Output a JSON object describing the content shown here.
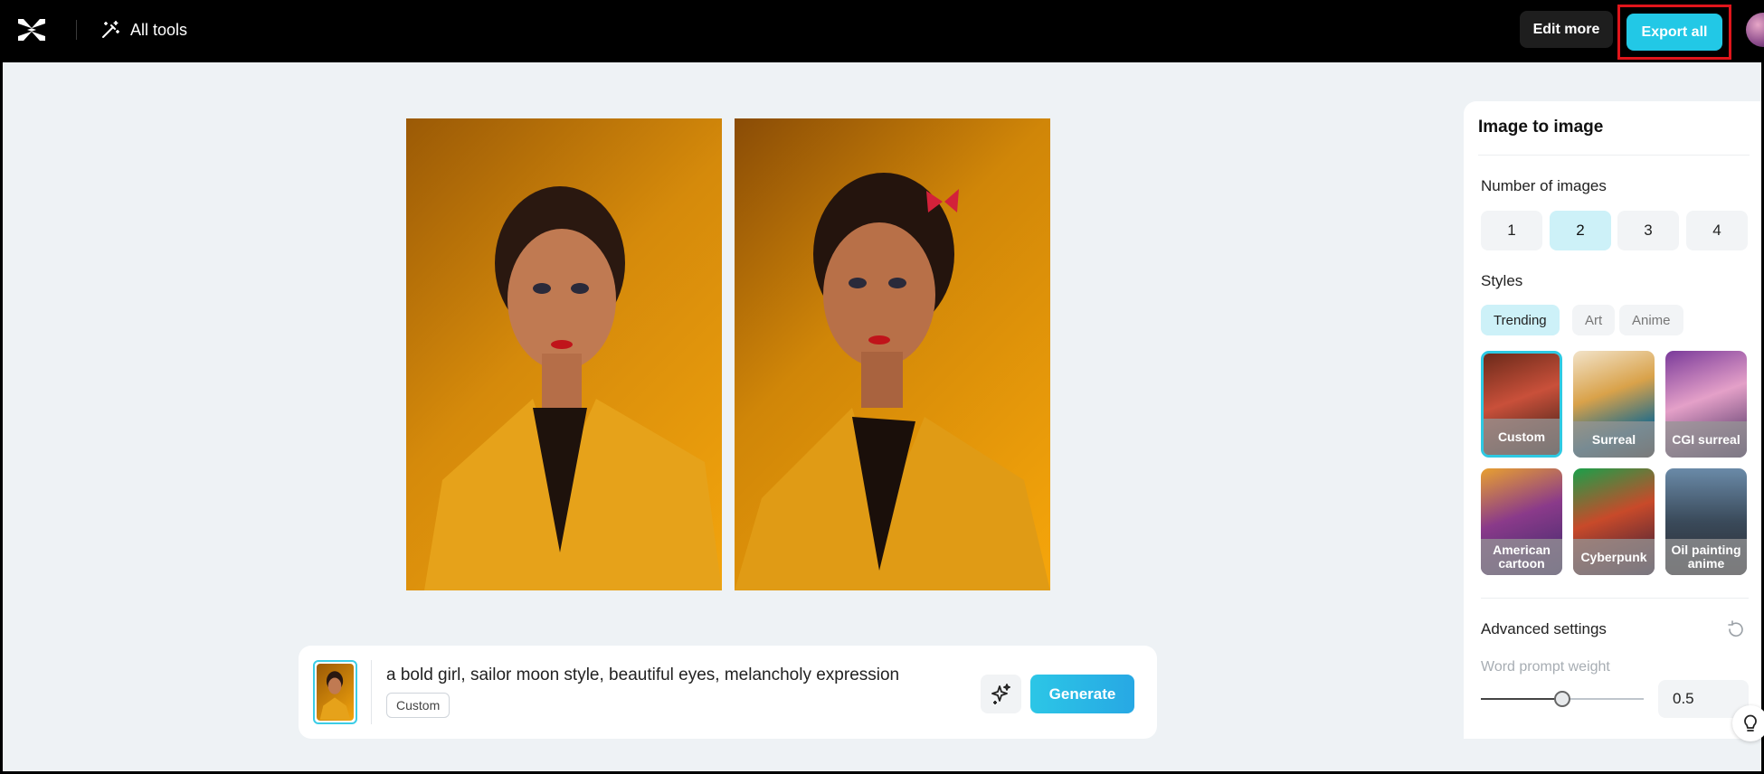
{
  "topbar": {
    "all_tools_label": "All tools",
    "edit_more_label": "Edit more",
    "export_all_label": "Export all"
  },
  "prompt": {
    "text": "a bold girl, sailor moon style, beautiful eyes, melancholy expression",
    "style_chip": "Custom",
    "generate_label": "Generate"
  },
  "panel": {
    "title": "Image to image",
    "number_label": "Number of images",
    "numbers": [
      "1",
      "2",
      "3",
      "4"
    ],
    "selected_number": "2",
    "styles_label": "Styles",
    "style_tabs": [
      "Trending",
      "Art",
      "Anime"
    ],
    "active_tab": "Trending",
    "styles": [
      {
        "label": "Custom"
      },
      {
        "label": "Surreal"
      },
      {
        "label": "CGI surreal"
      },
      {
        "label": "American cartoon"
      },
      {
        "label": "Cyberpunk"
      },
      {
        "label": "Oil painting anime"
      }
    ],
    "advanced_label": "Advanced settings",
    "word_weight_label": "Word prompt weight",
    "word_weight_value": "0.5"
  },
  "colors": {
    "accent": "#22c8e6",
    "highlight_border": "#e0151b",
    "selected_bg": "#cdf1f8"
  }
}
